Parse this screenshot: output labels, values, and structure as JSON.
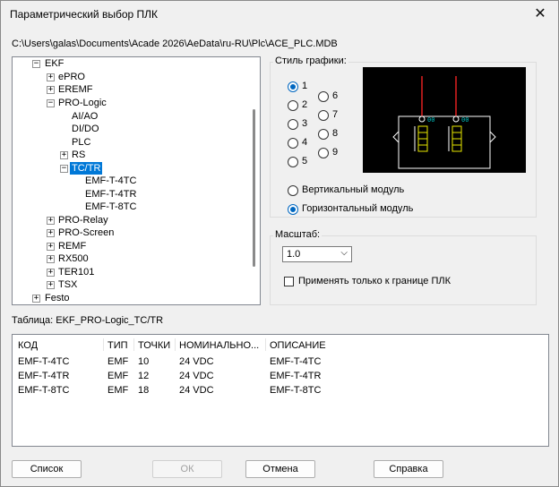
{
  "window": {
    "title": "Параметрический выбор ПЛК",
    "close_glyph": "✕"
  },
  "path": "C:\\Users\\galas\\Documents\\Acade 2026\\AeData\\ru-RU\\Plc\\ACE_PLC.MDB",
  "tree": {
    "items": [
      {
        "label": "EKF",
        "expander": "−"
      },
      {
        "label": "ePRO",
        "expander": "+"
      },
      {
        "label": "EREMF",
        "expander": "+"
      },
      {
        "label": "PRO-Logic",
        "expander": "−"
      },
      {
        "label": "AI/AO",
        "expander": ""
      },
      {
        "label": "DI/DO",
        "expander": ""
      },
      {
        "label": "PLC",
        "expander": ""
      },
      {
        "label": "RS",
        "expander": "+"
      },
      {
        "label": "TC/TR",
        "expander": "−",
        "selected": true
      },
      {
        "label": "EMF-T-4TC",
        "expander": ""
      },
      {
        "label": "EMF-T-4TR",
        "expander": ""
      },
      {
        "label": "EMF-T-8TC",
        "expander": ""
      },
      {
        "label": "PRO-Relay",
        "expander": "+"
      },
      {
        "label": "PRO-Screen",
        "expander": "+"
      },
      {
        "label": "REMF",
        "expander": "+"
      },
      {
        "label": "RX500",
        "expander": "+"
      },
      {
        "label": "TER101",
        "expander": "+"
      },
      {
        "label": "TSX",
        "expander": "+"
      },
      {
        "label": "Festo",
        "expander": "+"
      }
    ]
  },
  "style_group": {
    "label": "Стиль графики:",
    "options": [
      "1",
      "2",
      "3",
      "4",
      "5",
      "6",
      "7",
      "8",
      "9"
    ],
    "selected": "1",
    "orientation": [
      {
        "label": "Вертикальный модуль",
        "selected": false
      },
      {
        "label": "Горизонтальный модуль",
        "selected": true
      }
    ]
  },
  "scale_group": {
    "label": "Масштаб:",
    "value": "1.0",
    "checkbox_label": "Применять только к границе ПЛК",
    "checkbox_checked": false
  },
  "table": {
    "label": "Таблица: EKF_PRO-Logic_TC/TR",
    "columns": [
      "КОД",
      "ТИП",
      "ТОЧКИ",
      "НОМИНАЛЬНО...",
      "ОПИСАНИЕ"
    ],
    "rows": [
      [
        "EMF-T-4TC",
        "EMF",
        "10",
        "24 VDC",
        "EMF-T-4TC"
      ],
      [
        "EMF-T-4TR",
        "EMF",
        "12",
        "24 VDC",
        "EMF-T-4TR"
      ],
      [
        "EMF-T-8TC",
        "EMF",
        "18",
        "24 VDC",
        "EMF-T-8TC"
      ]
    ]
  },
  "buttons": {
    "list": "Список",
    "ok": "ОК",
    "cancel": "Отмена",
    "help": "Справка"
  },
  "colors": {
    "accent": "#0078d7",
    "radio_on": "#0067c0",
    "preview_bg": "#000000"
  }
}
